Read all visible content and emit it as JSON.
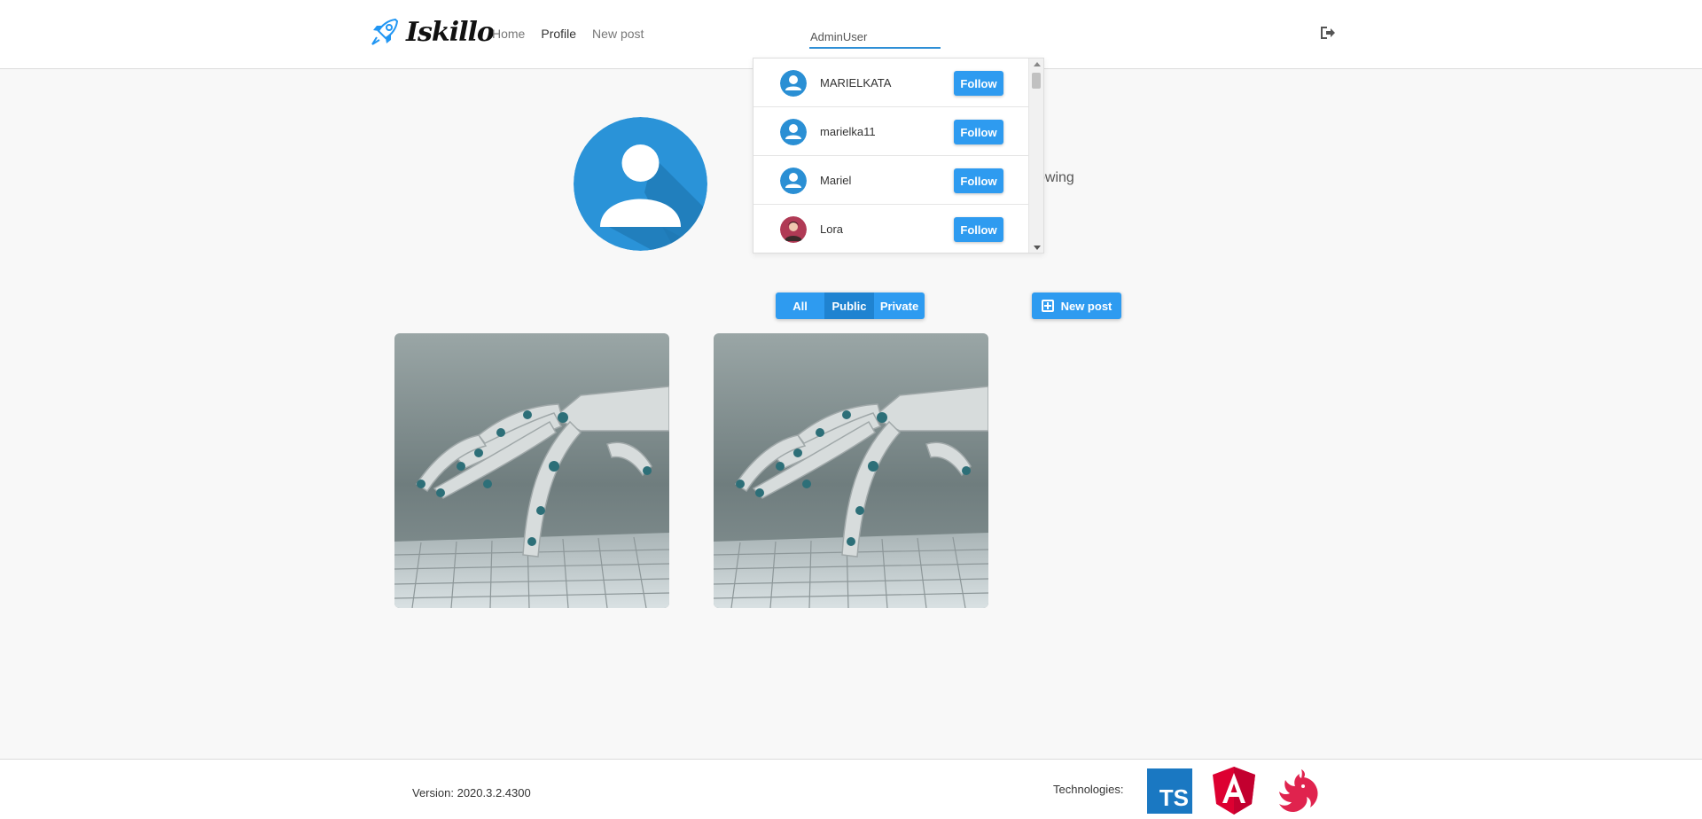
{
  "header": {
    "logo_text": "Iskillo",
    "nav": {
      "home": "Home",
      "profile": "Profile",
      "new_post": "New post"
    },
    "search_value": "AdminUser"
  },
  "search_results": [
    {
      "name": "MARIELKATA",
      "button": "Follow",
      "avatar": "default-user-icon"
    },
    {
      "name": "marielka11",
      "button": "Follow",
      "avatar": "default-user-icon"
    },
    {
      "name": "Mariel",
      "button": "Follow",
      "avatar": "default-user-icon"
    },
    {
      "name": "Lora",
      "button": "Follow",
      "avatar": "user-photo"
    }
  ],
  "profile": {
    "following_partial": "owing"
  },
  "filters": {
    "all": "All",
    "public": "Public",
    "private": "Private",
    "selected": "Public"
  },
  "new_post_button": "New post",
  "posts": [
    {
      "image": "robot-hand-typing-on-keyboard"
    },
    {
      "image": "robot-hand-typing-on-keyboard"
    }
  ],
  "footer": {
    "version": "Version: 2020.3.2.4300",
    "technologies_label": "Technologies:",
    "ts_logo_text": "TS"
  },
  "colors": {
    "accent": "#2e9bf0",
    "accent_dark": "#1f83d1",
    "avatar_blue": "#2a8fd4"
  }
}
